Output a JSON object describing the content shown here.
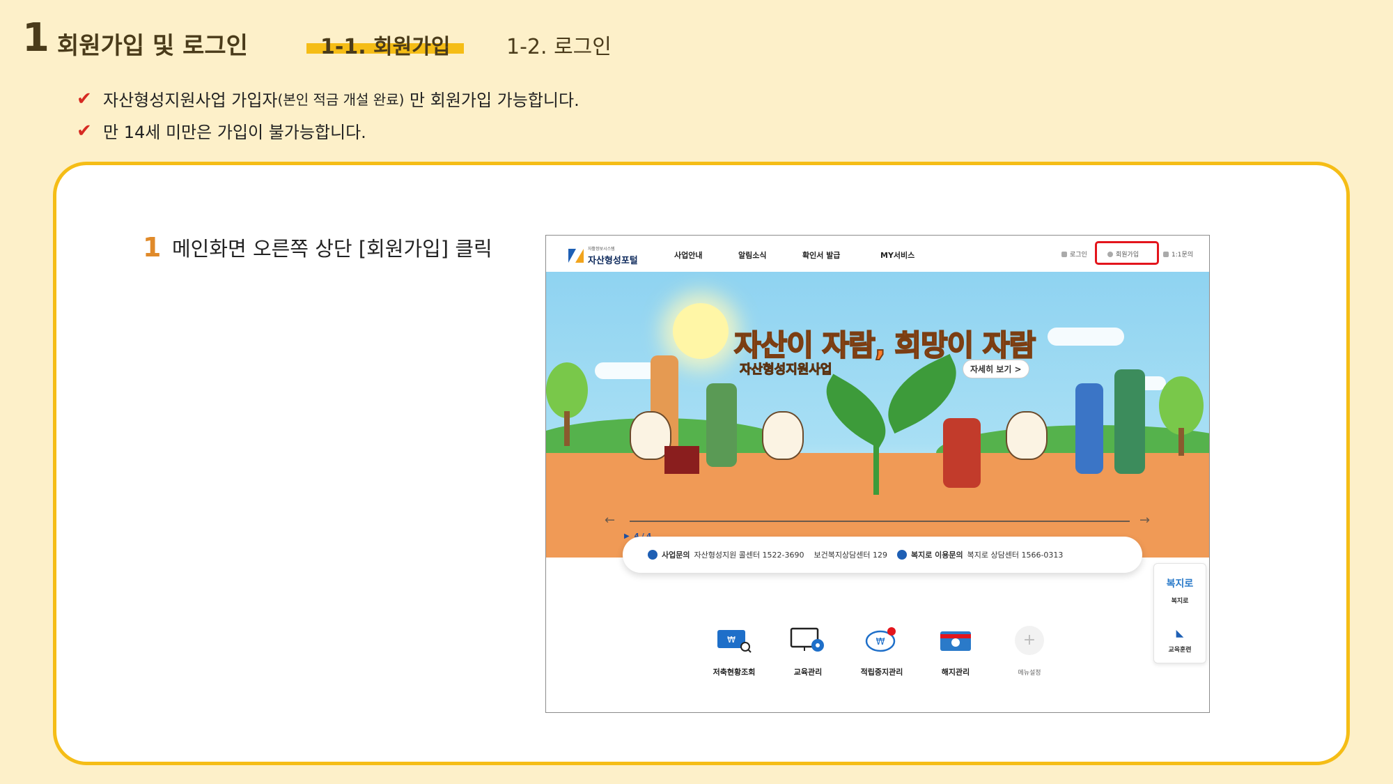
{
  "header": {
    "section_number": "1",
    "section_title": "회원가입 및 로그인",
    "tab_active": "1-1. 회원가입",
    "tab_inactive": "1-2. 로그인"
  },
  "notices": {
    "check_glyph": "✔",
    "line1_main": "자산형성지원사업 가입자",
    "line1_small": "(본인 적금 개설 완료)",
    "line1_end": " 만 회원가입 가능합니다.",
    "line2": "만 14세 미만은 가입이 불가능합니다."
  },
  "step": {
    "number": "1",
    "text": "메인화면 오른쪽 상단 [회원가입] 클릭"
  },
  "screenshot": {
    "logo_sub": "자활정보시스템",
    "logo_text": "자산형성포털",
    "menu": [
      "사업안내",
      "알림소식",
      "확인서 발급",
      "MY서비스"
    ],
    "util": {
      "login": "로그인",
      "join": "회원가입",
      "inquiry": "1:1문의"
    },
    "banner_title": "자산이 자람, 희망이 자람",
    "banner_subtitle": "자산형성지원사업",
    "banner_more": "자세히 보기 >",
    "slide_indicator": "▶  4 / 4",
    "arrow_prev": "←",
    "arrow_next": "→",
    "contact": {
      "label1": "사업문의",
      "text1": "자산형성지원 콜센터 1522-3690",
      "text2": "보건복지상담센터 129",
      "label2": "복지로 이용문의",
      "text3": "복지로 상담센터 1566-0313"
    },
    "side": {
      "item1_logo": "복지로",
      "item1_label": "복지로",
      "item2_label": "교육훈련"
    },
    "quick": [
      {
        "label": "저축현황조회"
      },
      {
        "label": "교육관리"
      },
      {
        "label": "적립중지관리"
      },
      {
        "label": "해지관리"
      },
      {
        "label": "메뉴설정"
      }
    ],
    "colors": {
      "highlight_box": "#e3151c",
      "brand_blue": "#1e5fb4",
      "accent_orange": "#f2a41c"
    }
  }
}
